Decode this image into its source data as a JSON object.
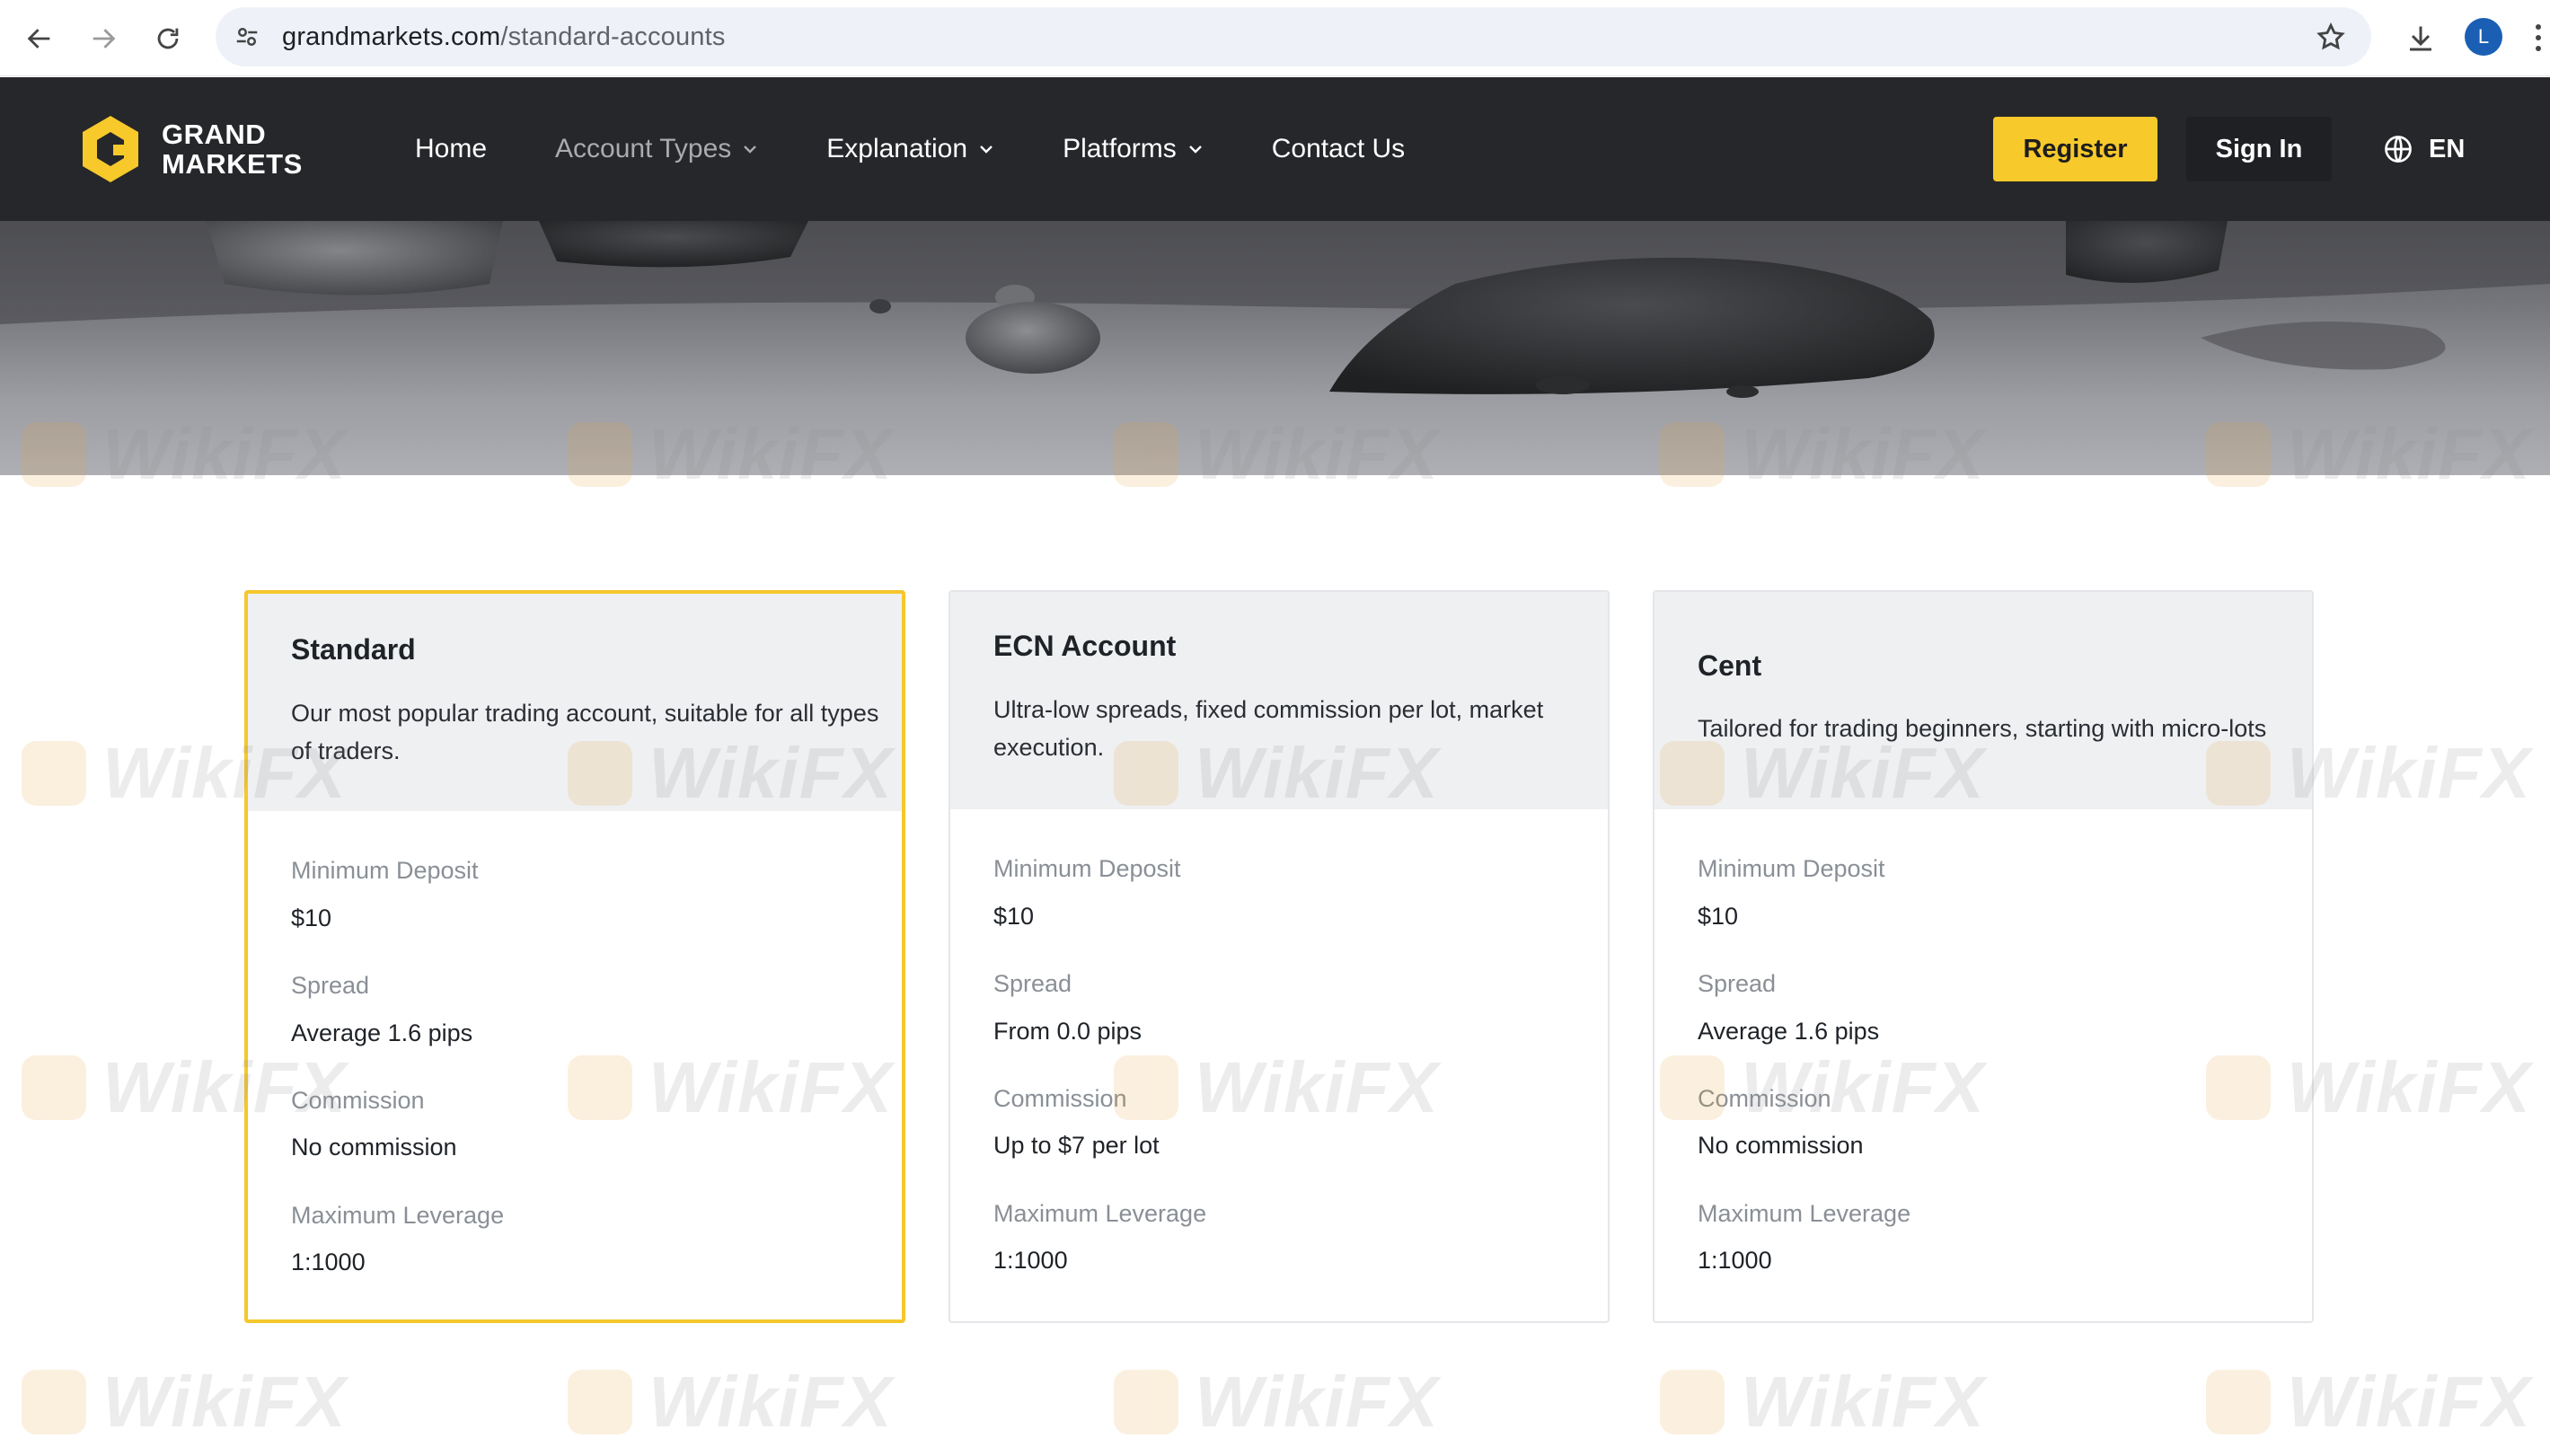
{
  "browser": {
    "url_host": "grandmarkets.com",
    "url_path": "/standard-accounts",
    "profile_initial": "L"
  },
  "brand": {
    "line1": "GRAND",
    "line2": "MARKETS",
    "accent_color": "#f7c92b",
    "header_bg": "#25272a"
  },
  "nav": {
    "items": [
      {
        "label": "Home",
        "has_dropdown": false
      },
      {
        "label": "Account Types",
        "has_dropdown": true
      },
      {
        "label": "Explanation",
        "has_dropdown": true
      },
      {
        "label": "Platforms",
        "has_dropdown": true
      },
      {
        "label": "Contact Us",
        "has_dropdown": false
      }
    ],
    "register_label": "Register",
    "signin_label": "Sign In",
    "language_label": "EN"
  },
  "accounts": [
    {
      "title": "Standard",
      "description": "Our most popular trading account, suitable for all types of traders.",
      "selected": true,
      "min_deposit_label": "Minimum Deposit",
      "min_deposit": "$10",
      "spread_label": "Spread",
      "spread": "Average 1.6 pips",
      "commission_label": "Commission",
      "commission": "No commission",
      "leverage_label": "Maximum Leverage",
      "leverage": "1:1000"
    },
    {
      "title": "ECN Account",
      "description": "Ultra-low spreads, fixed commission per lot, market execution.",
      "selected": false,
      "min_deposit_label": "Minimum Deposit",
      "min_deposit": "$10",
      "spread_label": "Spread",
      "spread": "From 0.0 pips",
      "commission_label": "Commission",
      "commission": "Up to $7 per lot",
      "leverage_label": "Maximum Leverage",
      "leverage": "1:1000"
    },
    {
      "title": "Cent",
      "description": "Tailored for trading beginners, starting with micro-lots",
      "selected": false,
      "min_deposit_label": "Minimum Deposit",
      "min_deposit": "$10",
      "spread_label": "Spread",
      "spread": "Average 1.6 pips",
      "commission_label": "Commission",
      "commission": "No commission",
      "leverage_label": "Maximum Leverage",
      "leverage": "1:1000"
    }
  ],
  "watermark": {
    "text": "WikiFX"
  }
}
